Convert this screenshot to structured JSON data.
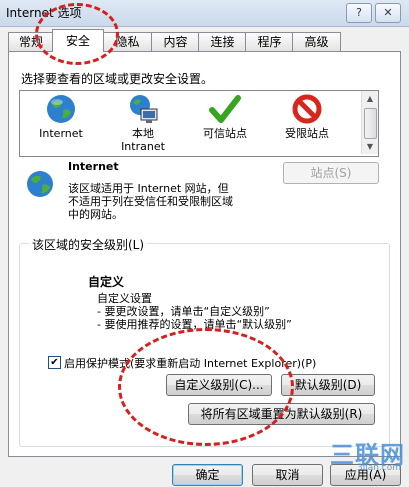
{
  "window": {
    "title": "Internet 选项",
    "help_label": "?",
    "close_label": "✕"
  },
  "tabs": [
    {
      "label": "常规"
    },
    {
      "label": "安全"
    },
    {
      "label": "隐私"
    },
    {
      "label": "内容"
    },
    {
      "label": "连接"
    },
    {
      "label": "程序"
    },
    {
      "label": "高级"
    }
  ],
  "active_tab": "安全",
  "security": {
    "instruction": "选择要查看的区域或更改安全设置。",
    "zones": [
      {
        "name": "Internet",
        "icon": "globe-icon"
      },
      {
        "name": "本地\nIntranet",
        "icon": "intranet-globe-icon"
      },
      {
        "name": "可信站点",
        "icon": "checkmark-icon"
      },
      {
        "name": "受限站点",
        "icon": "restricted-icon"
      }
    ],
    "selected_zone": {
      "title": "Internet",
      "description_1": "该区域适用于 Internet 网站，但",
      "description_2": "不适用于列在受信任和受限制区域",
      "description_3": "中的网站。"
    },
    "sites_button": "站点(S)",
    "level_group_label": "该区域的安全级别(L)",
    "level": {
      "title": "自定义",
      "line_1": "自定义设置",
      "line_2": "- 要更改设置，请单击“自定义级别”",
      "line_3": "- 要使用推荐的设置，请单击“默认级别”"
    },
    "protected_mode": {
      "label": "启用保护模式(要求重新启动 Internet Explorer)(P)",
      "checked": true
    },
    "custom_level_button": "自定义级别(C)...",
    "default_level_button": "默认级别(D)",
    "reset_all_button": "将所有区域重置为默认级别(R)"
  },
  "footer": {
    "ok": "确定",
    "cancel": "取消",
    "apply": "应用(A)"
  },
  "watermark": {
    "main": "三联网",
    "sub": "3lian.com"
  },
  "colors": {
    "annotation_red": "#d62020",
    "watermark": "#4a8fd6"
  }
}
